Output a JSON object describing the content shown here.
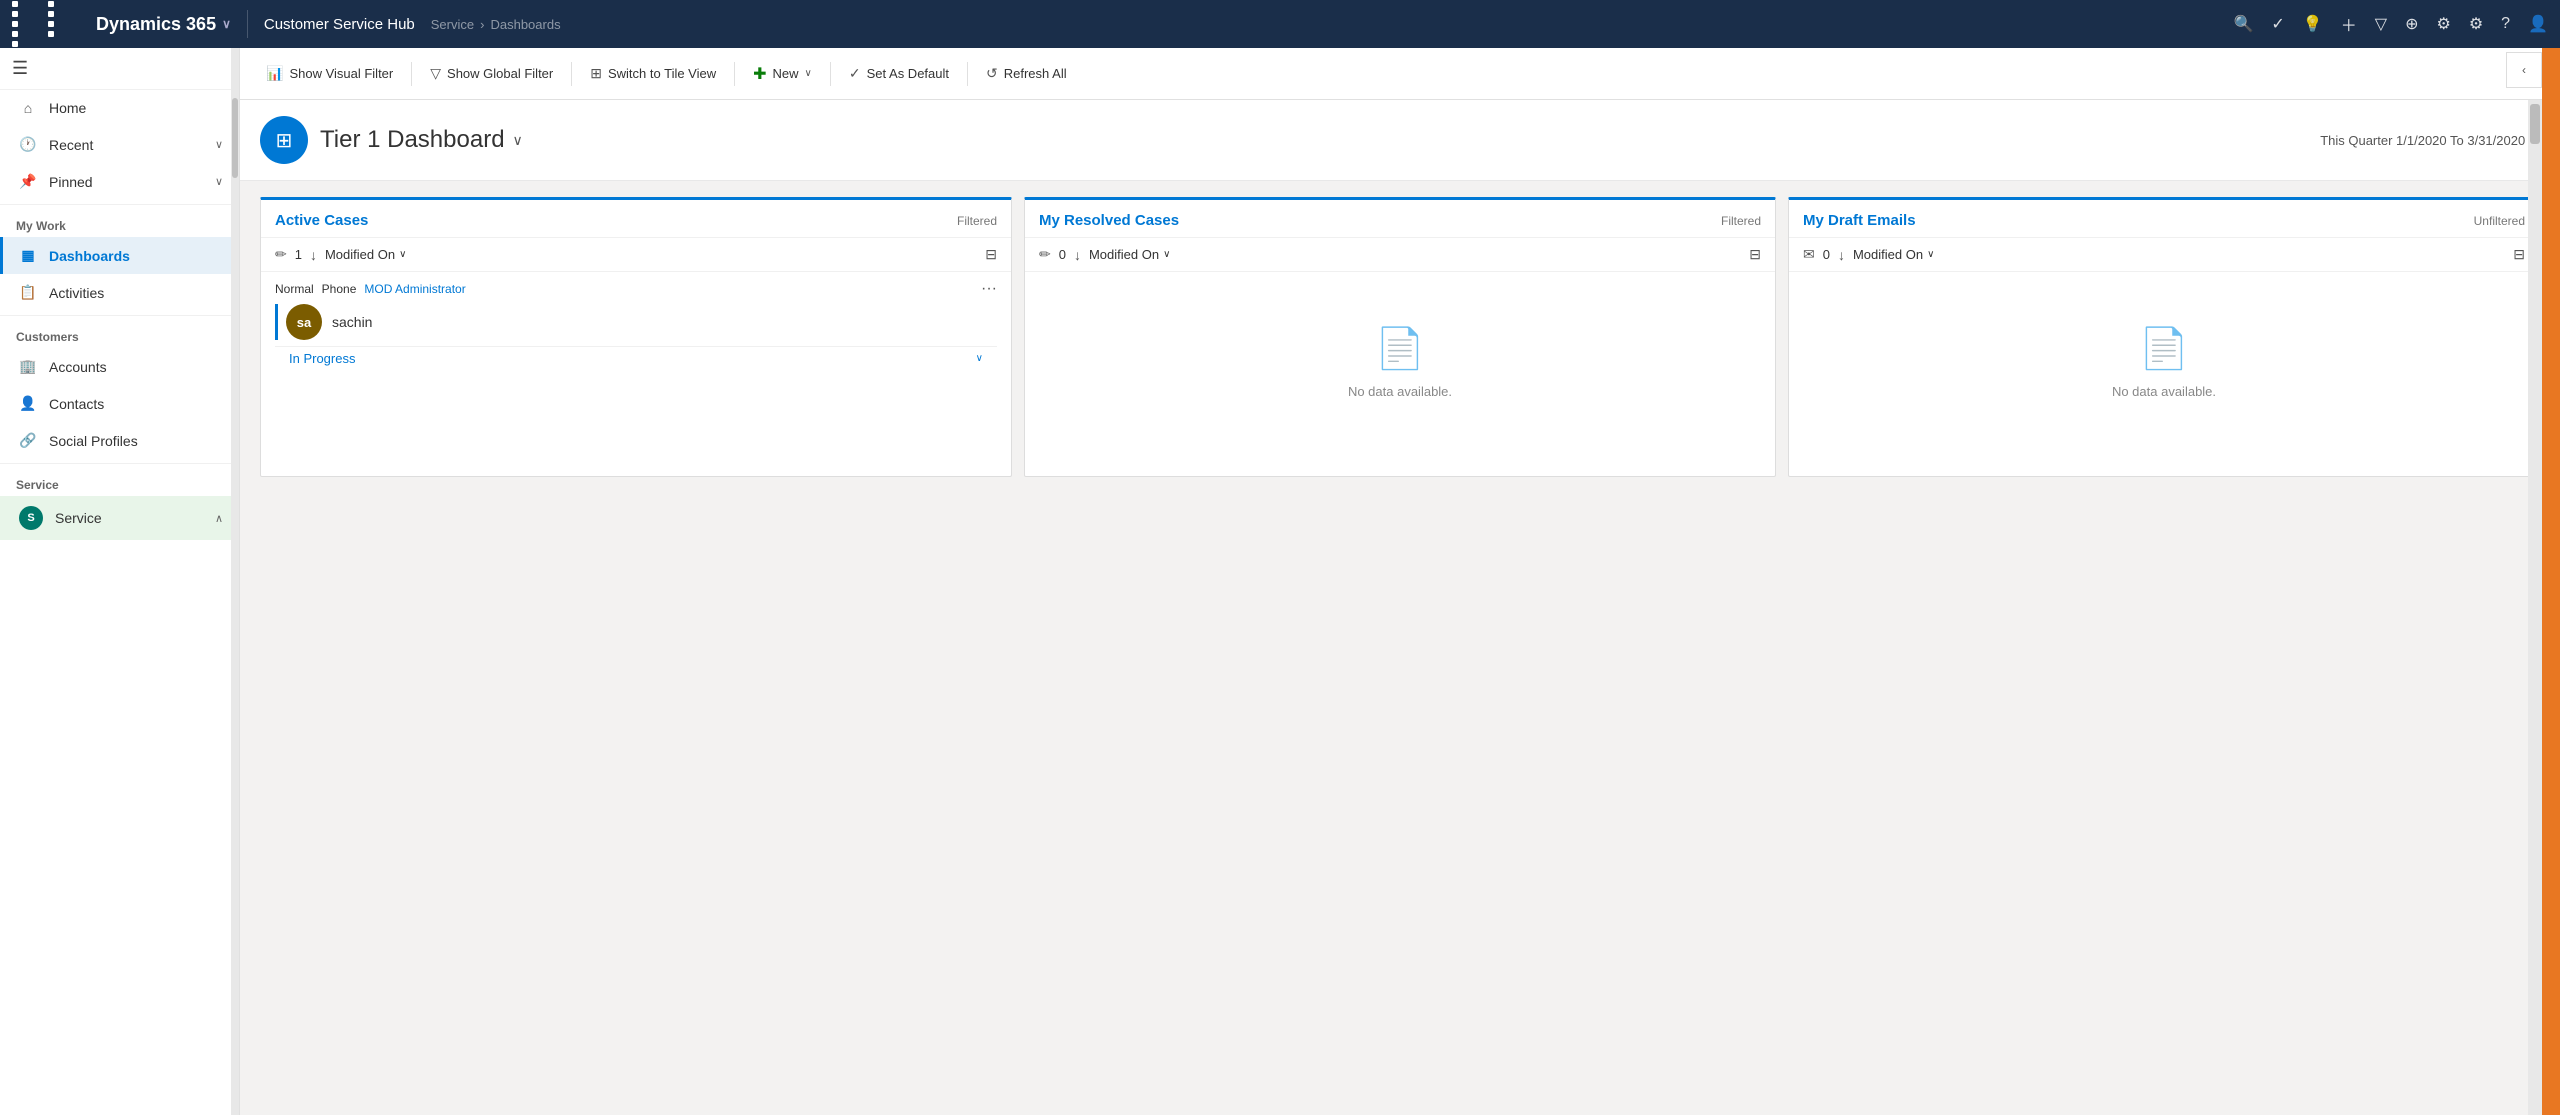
{
  "app": {
    "name": "Dynamics 365",
    "chevron": "∨"
  },
  "topnav": {
    "app_name": "Customer Service Hub",
    "breadcrumb": [
      "Service",
      ">",
      "Dashboards"
    ],
    "icons": [
      "search",
      "task",
      "lightbulb",
      "plus",
      "filter",
      "circle-plus",
      "settings-alt",
      "settings",
      "help",
      "user"
    ]
  },
  "sidebar": {
    "hamburger": "☰",
    "items": [
      {
        "id": "home",
        "label": "Home",
        "icon": "⌂",
        "type": "nav"
      },
      {
        "id": "recent",
        "label": "Recent",
        "icon": "🕐",
        "type": "nav",
        "has_chevron": true
      },
      {
        "id": "pinned",
        "label": "Pinned",
        "icon": "📌",
        "type": "nav",
        "has_chevron": true
      }
    ],
    "sections": [
      {
        "title": "My Work",
        "items": [
          {
            "id": "dashboards",
            "label": "Dashboards",
            "icon": "▦",
            "active": true
          },
          {
            "id": "activities",
            "label": "Activities",
            "icon": "📋"
          }
        ]
      },
      {
        "title": "Customers",
        "items": [
          {
            "id": "accounts",
            "label": "Accounts",
            "icon": "🏢"
          },
          {
            "id": "contacts",
            "label": "Contacts",
            "icon": "👤"
          },
          {
            "id": "social-profiles",
            "label": "Social Profiles",
            "icon": "🔗"
          }
        ]
      },
      {
        "title": "Service",
        "items": [
          {
            "id": "service",
            "label": "Service",
            "icon": "S",
            "has_chevron": true
          }
        ]
      }
    ]
  },
  "toolbar": {
    "buttons": [
      {
        "id": "show-visual-filter",
        "icon": "📊",
        "label": "Show Visual Filter"
      },
      {
        "id": "show-global-filter",
        "icon": "▽",
        "label": "Show Global Filter"
      },
      {
        "id": "switch-tile-view",
        "icon": "⊞",
        "label": "Switch to Tile View"
      },
      {
        "id": "new",
        "icon": "+",
        "label": "New",
        "has_chevron": true
      },
      {
        "id": "set-default",
        "icon": "✓",
        "label": "Set As Default"
      },
      {
        "id": "refresh-all",
        "icon": "↺",
        "label": "Refresh All"
      }
    ]
  },
  "dashboard": {
    "icon": "⊞",
    "title": "Tier 1 Dashboard",
    "date_range": "This Quarter 1/1/2020 To 3/31/2020"
  },
  "cards": [
    {
      "id": "active-cases",
      "title": "Active Cases",
      "filter_label": "Filtered",
      "count": 1,
      "sort_field": "Modified On",
      "items": [
        {
          "type": "Normal",
          "channel": "Phone",
          "owner": "MOD Administrator",
          "avatar_initials": "sa",
          "avatar_color": "#7b5c00",
          "name": "sachin",
          "status": "In Progress",
          "has_data": true
        }
      ]
    },
    {
      "id": "my-resolved-cases",
      "title": "My Resolved Cases",
      "filter_label": "Filtered",
      "count": 0,
      "sort_field": "Modified On",
      "no_data_text": "No data available.",
      "has_data": false
    },
    {
      "id": "my-draft-emails",
      "title": "My Draft Emails",
      "filter_label": "Unfiltered",
      "count": 0,
      "sort_field": "Modified On",
      "no_data_text": "No data available.",
      "has_data": false,
      "icon": "✉"
    }
  ]
}
